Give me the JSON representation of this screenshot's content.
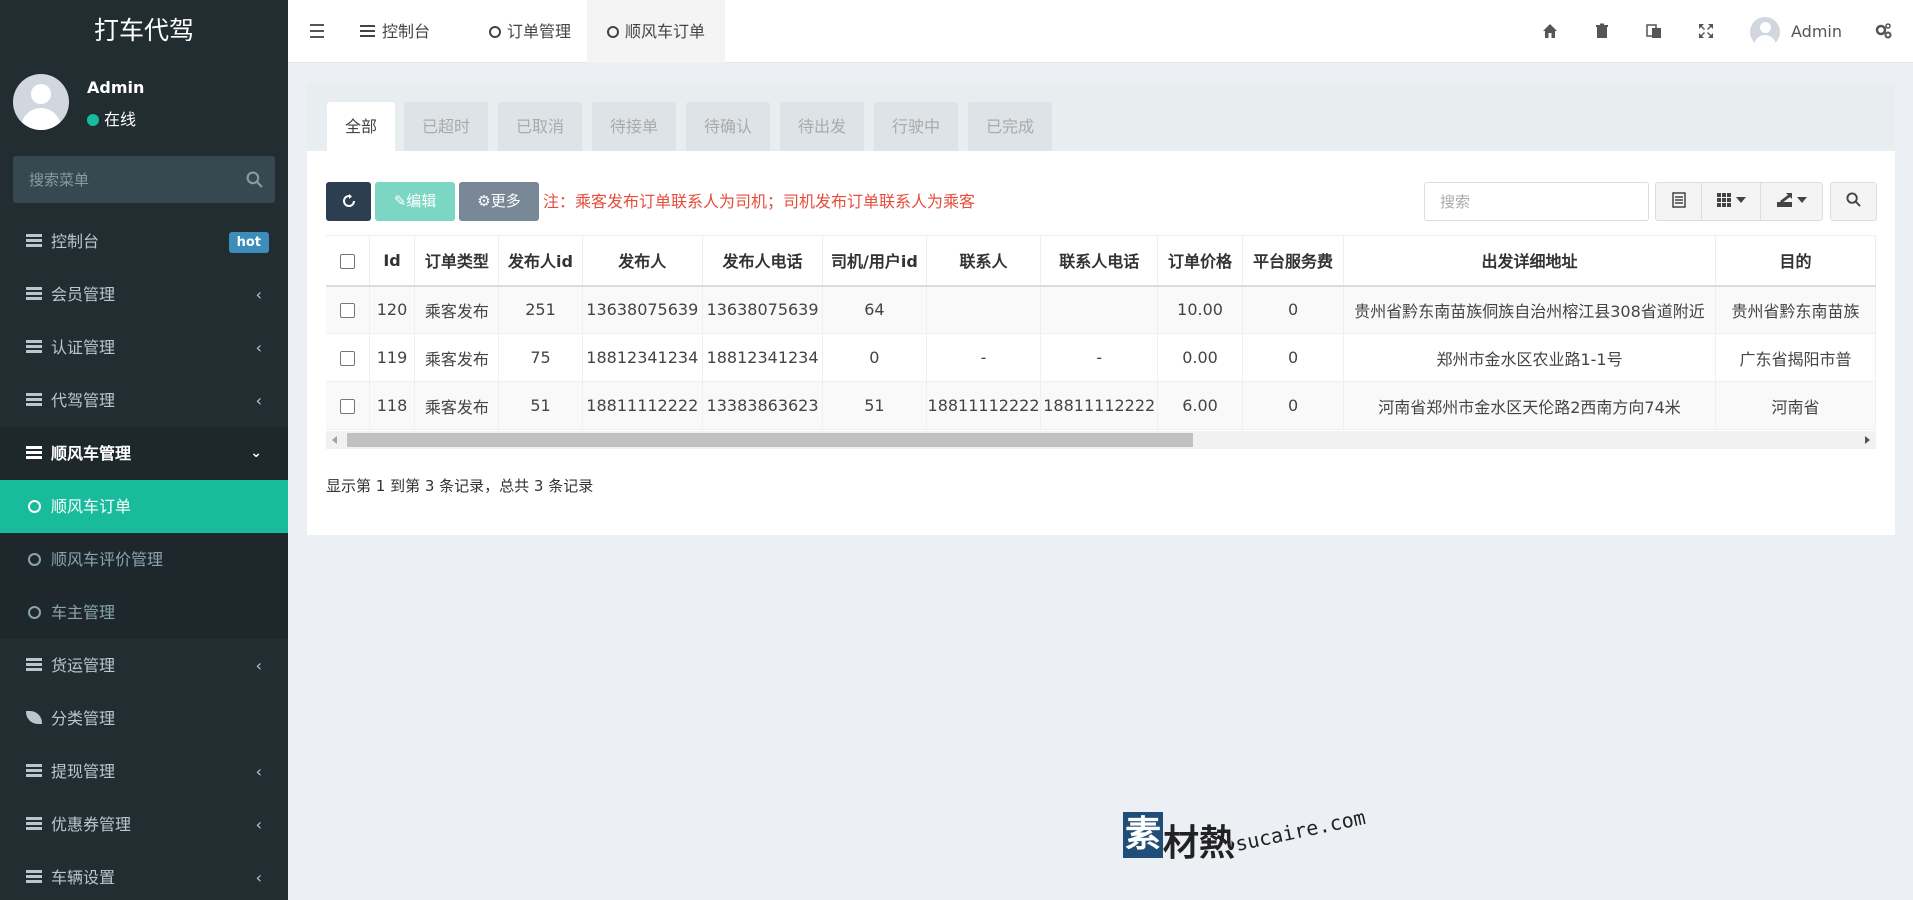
{
  "brand": "打车代驾",
  "user": {
    "name": "Admin",
    "status": "在线"
  },
  "sidebar": {
    "search_placeholder": "搜索菜单",
    "items": [
      {
        "label": "控制台",
        "badge": "hot"
      },
      {
        "label": "会员管理"
      },
      {
        "label": "认证管理"
      },
      {
        "label": "代驾管理"
      },
      {
        "label": "顺风车管理"
      },
      {
        "label": "货运管理"
      },
      {
        "label": "分类管理"
      },
      {
        "label": "提现管理"
      },
      {
        "label": "优惠券管理"
      },
      {
        "label": "车辆设置"
      }
    ],
    "submenu": [
      {
        "label": "顺风车订单"
      },
      {
        "label": "顺风车评价管理"
      },
      {
        "label": "车主管理"
      }
    ]
  },
  "topnav": {
    "tabs": [
      {
        "label": "控制台"
      },
      {
        "label": "订单管理"
      },
      {
        "label": "顺风车订单"
      }
    ],
    "admin": "Admin"
  },
  "status_tabs": [
    "全部",
    "已超时",
    "已取消",
    "待接单",
    "待确认",
    "待出发",
    "行驶中",
    "已完成"
  ],
  "toolbar": {
    "edit_label": "编辑",
    "more_label": "更多",
    "note": "注：乘客发布订单联系人为司机；司机发布订单联系人为乘客",
    "search_placeholder": "搜索"
  },
  "table": {
    "columns": [
      "Id",
      "订单类型",
      "发布人id",
      "发布人",
      "发布人电话",
      "司机/用户id",
      "联系人",
      "联系人电话",
      "订单价格",
      "平台服务费",
      "出发详细地址",
      "目的"
    ],
    "rows": [
      [
        "120",
        "乘客发布",
        "251",
        "13638075639",
        "13638075639",
        "64",
        "",
        "",
        "10.00",
        "0",
        "贵州省黔东南苗族侗族自治州榕江县308省道附近",
        "贵州省黔东南苗族"
      ],
      [
        "119",
        "乘客发布",
        "75",
        "18812341234",
        "18812341234",
        "0",
        "-",
        "-",
        "0.00",
        "0",
        "郑州市金水区农业路1-1号",
        "广东省揭阳市普"
      ],
      [
        "118",
        "乘客发布",
        "51",
        "18811112222",
        "13383863623",
        "51",
        "18811112222",
        "18811112222",
        "6.00",
        "0",
        "河南省郑州市金水区天伦路2西南方向74米",
        "河南省"
      ]
    ]
  },
  "pagination_info": "显示第 1 到第 3 条记录，总共 3 条记录",
  "watermark": {
    "cn": "素材熱",
    "box": "素",
    "cn_rest": "材熱",
    "en": "sucaire.com"
  },
  "colors": {
    "sidebar_bg": "#222d32",
    "accent": "#18bc9c",
    "note": "#e74c3c",
    "hot_badge": "#3c8dbc"
  }
}
